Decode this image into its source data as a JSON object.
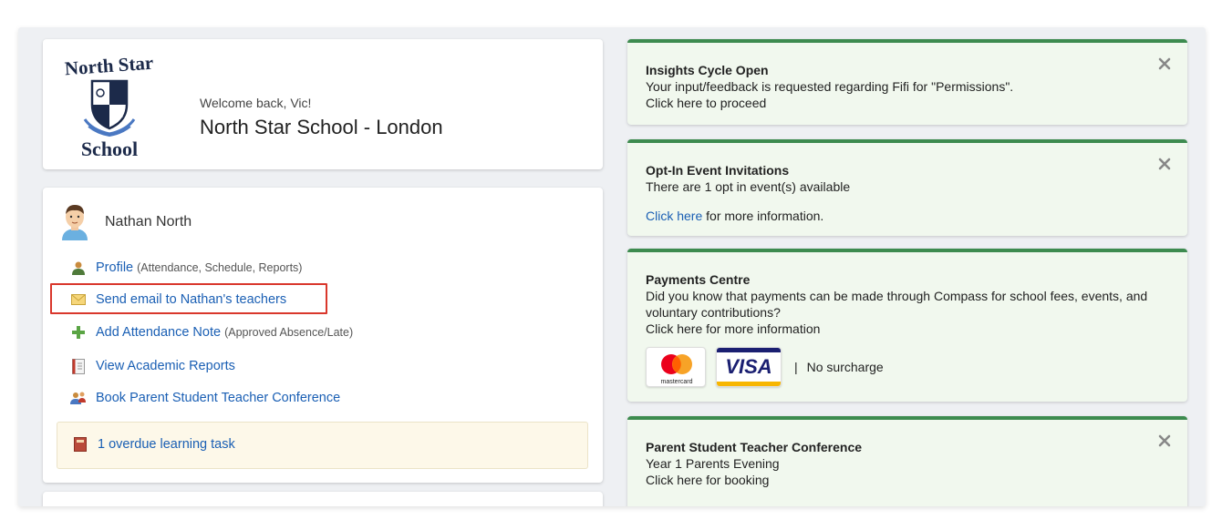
{
  "school": {
    "logo_text_top": "North Star",
    "logo_text_bottom": "School",
    "welcome": "Welcome back, Vic!",
    "name": "North Star School - London"
  },
  "student": {
    "name": "Nathan North",
    "links": [
      {
        "label": "Profile",
        "note": "(Attendance, Schedule, Reports)",
        "icon": "profile-icon"
      },
      {
        "label": "Send email to Nathan's teachers",
        "note": "",
        "icon": "envelope-icon"
      },
      {
        "label": "Add Attendance Note",
        "note": "(Approved Absence/Late)",
        "icon": "plus-icon"
      },
      {
        "label": "View Academic Reports",
        "note": "",
        "icon": "report-icon"
      },
      {
        "label": "Book Parent Student Teacher Conference",
        "note": "",
        "icon": "conference-icon"
      }
    ],
    "overdue": "1 overdue learning task"
  },
  "notices": [
    {
      "title": "Insights Cycle Open",
      "line1": "Your input/feedback is requested regarding Fifi for \"Permissions\".",
      "link": "Click here to proceed"
    },
    {
      "title": "Opt-In Event Invitations",
      "line1": "There are 1 opt in event(s) available",
      "link": "Click here",
      "link_suffix": "for more information."
    },
    {
      "title": "Payments Centre",
      "line1": "Did you know that payments can be made through Compass for school fees, events, and",
      "line2": "voluntary contributions?",
      "link": "Click here for more information",
      "mastercard": "mastercard",
      "visa": "VISA",
      "separator": "|",
      "surcharge": "No surcharge"
    },
    {
      "title": "Parent Student Teacher Conference",
      "line1": "Year 1 Parents Evening",
      "link": "Click here for booking"
    }
  ],
  "colors": {
    "accent_green": "#3d8b4f",
    "link_blue": "#1a5fb4",
    "highlight_red": "#d9372c"
  }
}
